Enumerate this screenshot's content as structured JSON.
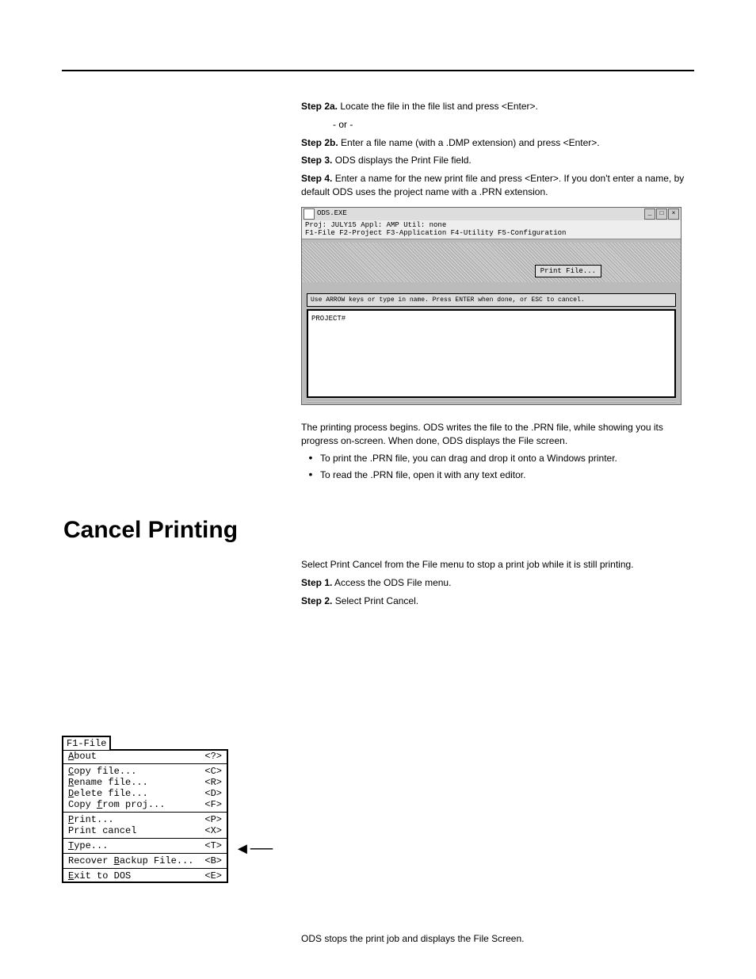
{
  "header_chapter": "",
  "page_number": "",
  "before_screenshot": {
    "step_a_bold": "Step 2a.",
    "step_a_text": " Locate the file in the file list and press <Enter>.",
    "or_text": "- or -",
    "step_b_bold": "Step 2b.",
    "step_b_text": " Enter a file name (with a .DMP extension) and press <Enter>.",
    "step3_bold": "Step 3.",
    "step3_text": " ODS displays the Print File field.",
    "step4_bold": "Step 4.",
    "step4_text": " Enter a name for the new print file and press <Enter>. If you don't enter a name, by default ODS uses the project name with a .PRN extension."
  },
  "after_screenshot": {
    "para1": "The printing process begins. ODS writes the file to the .PRN file, while showing you its progress on-screen. When done, ODS displays the File screen.",
    "bullet1": "To print the .PRN file, you can drag and drop it onto a Windows printer.",
    "bullet2": "To read the .PRN file, open it with any text editor."
  },
  "section_cancel": {
    "title": "Cancel Printing",
    "intro": "Select Print Cancel from the File menu to stop a print job while it is still printing.",
    "step1_bold": "Step 1.",
    "step1_text": " Access the ODS File menu.",
    "step2_bold": "Step 2.",
    "step2_text": " Select Print Cancel."
  },
  "screenshot": {
    "title": "ODS.EXE",
    "status_line1": "Proj: JULY15            Appl: AMP               Util: none",
    "status_line2": "F1-File  F2-Project  F3-Application  F4-Utility  F5-Configuration",
    "print_file_btn": "Print File...",
    "help_text": "Use ARROW keys or type in name. Press ENTER when done, or ESC to cancel.",
    "list_item": "PROJECT#"
  },
  "file_menu": {
    "tab": "F1-File",
    "items": [
      [
        {
          "pre": "",
          "u": "A",
          "post": "bout"
        },
        "<?>"
      ],
      "hr",
      [
        {
          "pre": "",
          "u": "C",
          "post": "opy file..."
        },
        "<C>"
      ],
      [
        {
          "pre": "",
          "u": "R",
          "post": "ename file..."
        },
        "<R>"
      ],
      [
        {
          "pre": "",
          "u": "D",
          "post": "elete file..."
        },
        "<D>"
      ],
      [
        {
          "pre": "Copy ",
          "u": "f",
          "post": "rom proj..."
        },
        "<F>"
      ],
      "hr",
      [
        {
          "pre": "",
          "u": "P",
          "post": "rint..."
        },
        "<P>"
      ],
      [
        {
          "pre": "Print cancel",
          "u": "",
          "post": ""
        },
        "<X>"
      ],
      "hr",
      [
        {
          "pre": "",
          "u": "T",
          "post": "ype..."
        },
        "<T>"
      ],
      "hr",
      [
        {
          "pre": "Recover ",
          "u": "B",
          "post": "ackup File..."
        },
        "<B>"
      ],
      "hr",
      [
        {
          "pre": "",
          "u": "E",
          "post": "xit to DOS"
        },
        "<E>"
      ]
    ]
  },
  "after_menu": {
    "text": "ODS stops the print job and displays the File Screen."
  }
}
